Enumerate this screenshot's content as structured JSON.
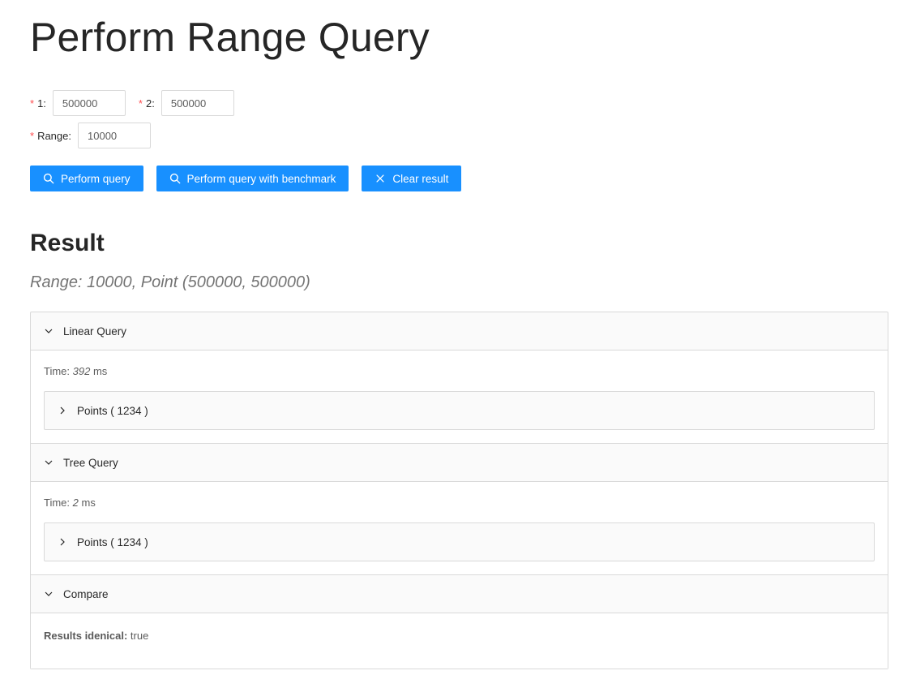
{
  "page": {
    "title": "Perform Range Query"
  },
  "form": {
    "field1": {
      "label": "1",
      "colon": ":",
      "value": "500000"
    },
    "field2": {
      "label": "2",
      "colon": ":",
      "value": "500000"
    },
    "range": {
      "label": "Range",
      "colon": ":",
      "value": "10000"
    },
    "required_mark": "*"
  },
  "buttons": {
    "perform_query": {
      "label": "Perform query",
      "icon": "search-icon"
    },
    "perform_benchmark": {
      "label": "Perform query with benchmark",
      "icon": "search-icon"
    },
    "clear_result": {
      "label": "Clear result",
      "icon": "close-icon"
    }
  },
  "result": {
    "title": "Result",
    "summary": "Range: 10000, Point (500000, 500000)",
    "panels": [
      {
        "header": "Linear Query",
        "expanded": true,
        "time_prefix": "Time: ",
        "time_value": "392",
        "time_unit": " ms",
        "points_label": "Points ( 1234 )"
      },
      {
        "header": "Tree Query",
        "expanded": true,
        "time_prefix": "Time: ",
        "time_value": "2",
        "time_unit": " ms",
        "points_label": "Points ( 1234 )"
      },
      {
        "header": "Compare",
        "expanded": true,
        "identical_label": "Results idenical:",
        "identical_value": " true"
      }
    ]
  },
  "colors": {
    "primary": "#1890ff",
    "required": "#ff4d4f",
    "border": "#d9d9d9",
    "panel_bg": "#fafafa"
  }
}
